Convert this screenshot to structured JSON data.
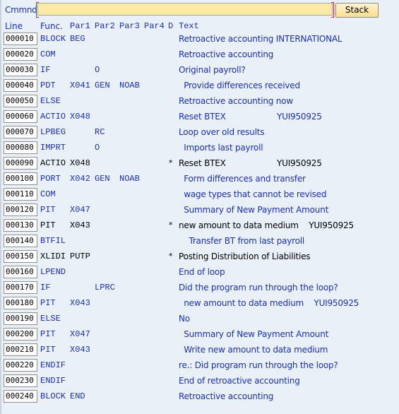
{
  "command": {
    "label": "Cmmnd",
    "value": "",
    "button": "Stack"
  },
  "headers": {
    "line": "Line",
    "func": "Func.",
    "par1": "Par1",
    "par2": "Par2",
    "par3": "Par3",
    "par4": "Par4",
    "d": "D",
    "text": "Text"
  },
  "rows": [
    {
      "line": "000010",
      "func": "BLOCK",
      "par1": "BEG",
      "par2": "",
      "par3": "",
      "d": "",
      "text": "Retroactive accounting INTERNATIONAL",
      "commented": false
    },
    {
      "line": "000020",
      "func": "COM",
      "par1": "",
      "par2": "",
      "par3": "",
      "d": "",
      "text": "Retroactive accounting",
      "commented": false
    },
    {
      "line": "000030",
      "func": "IF",
      "par1": "",
      "par2": "O",
      "par3": "",
      "d": "",
      "text": "Original payroll?",
      "commented": false
    },
    {
      "line": "000040",
      "func": "PDT",
      "par1": "X041",
      "par2": "GEN",
      "par3": "NOAB",
      "d": "",
      "text": "  Provide differences received",
      "commented": false
    },
    {
      "line": "000050",
      "func": "ELSE",
      "par1": "",
      "par2": "",
      "par3": "",
      "d": "",
      "text": "Retroactive accounting now",
      "commented": false
    },
    {
      "line": "000060",
      "func": "ACTIO",
      "par1": "X048",
      "par2": "",
      "par3": "",
      "d": "",
      "text": "Reset BTEX                    YUI950925",
      "commented": false
    },
    {
      "line": "000070",
      "func": "LPBEG",
      "par1": "",
      "par2": "RC",
      "par3": "",
      "d": "",
      "text": "Loop over old results",
      "commented": false
    },
    {
      "line": "000080",
      "func": "IMPRT",
      "par1": "",
      "par2": "O",
      "par3": "",
      "d": "",
      "text": "  Imports last payroll",
      "commented": false
    },
    {
      "line": "000090",
      "func": "ACTIO",
      "par1": "X048",
      "par2": "",
      "par3": "",
      "d": "*",
      "text": "Reset BTEX                    YUI950925",
      "commented": true
    },
    {
      "line": "000100",
      "func": "PORT",
      "par1": "X042",
      "par2": "GEN",
      "par3": "NOAB",
      "d": "",
      "text": "  Form differences and transfer",
      "commented": false
    },
    {
      "line": "000110",
      "func": "COM",
      "par1": "",
      "par2": "",
      "par3": "",
      "d": "",
      "text": "  wage types that cannot be revised",
      "commented": false
    },
    {
      "line": "000120",
      "func": "PIT",
      "par1": "X047",
      "par2": "",
      "par3": "",
      "d": "",
      "text": "  Summary of New Payment Amount",
      "commented": false
    },
    {
      "line": "000130",
      "func": "PIT",
      "par1": "X043",
      "par2": "",
      "par3": "",
      "d": "*",
      "text": "new amount to data medium    YUI950925",
      "commented": true
    },
    {
      "line": "000140",
      "func": "BTFIL",
      "par1": "",
      "par2": "",
      "par3": "",
      "d": "",
      "text": "    Transfer BT from last payroll",
      "commented": false
    },
    {
      "line": "000150",
      "func": "XLIDI",
      "par1": "PUTP",
      "par2": "",
      "par3": "",
      "d": "*",
      "text": "Posting Distribution of Liabilities",
      "commented": true
    },
    {
      "line": "000160",
      "func": "LPEND",
      "par1": "",
      "par2": "",
      "par3": "",
      "d": "",
      "text": "End of loop",
      "commented": false
    },
    {
      "line": "000170",
      "func": "IF",
      "par1": "",
      "par2": "LPRC",
      "par3": "",
      "d": "",
      "text": "Did the program run through the loop?",
      "commented": false
    },
    {
      "line": "000180",
      "func": "PIT",
      "par1": "X043",
      "par2": "",
      "par3": "",
      "d": "",
      "text": "  new amount to data medium    YUI950925",
      "commented": false
    },
    {
      "line": "000190",
      "func": "ELSE",
      "par1": "",
      "par2": "",
      "par3": "",
      "d": "",
      "text": "No",
      "commented": false
    },
    {
      "line": "000200",
      "func": "PIT",
      "par1": "X047",
      "par2": "",
      "par3": "",
      "d": "",
      "text": "  Summary of New Payment Amount",
      "commented": false
    },
    {
      "line": "000210",
      "func": "PIT",
      "par1": "X043",
      "par2": "",
      "par3": "",
      "d": "",
      "text": "  Write new amount to data medium",
      "commented": false
    },
    {
      "line": "000220",
      "func": "ENDIF",
      "par1": "",
      "par2": "",
      "par3": "",
      "d": "",
      "text": "re.: Did program run through the loop?",
      "commented": false
    },
    {
      "line": "000230",
      "func": "ENDIF",
      "par1": "",
      "par2": "",
      "par3": "",
      "d": "",
      "text": "End of retroactive accounting",
      "commented": false
    },
    {
      "line": "000240",
      "func": "BLOCK",
      "par1": "END",
      "par2": "",
      "par3": "",
      "d": "",
      "text": "Retroactive accounting",
      "commented": false
    }
  ]
}
